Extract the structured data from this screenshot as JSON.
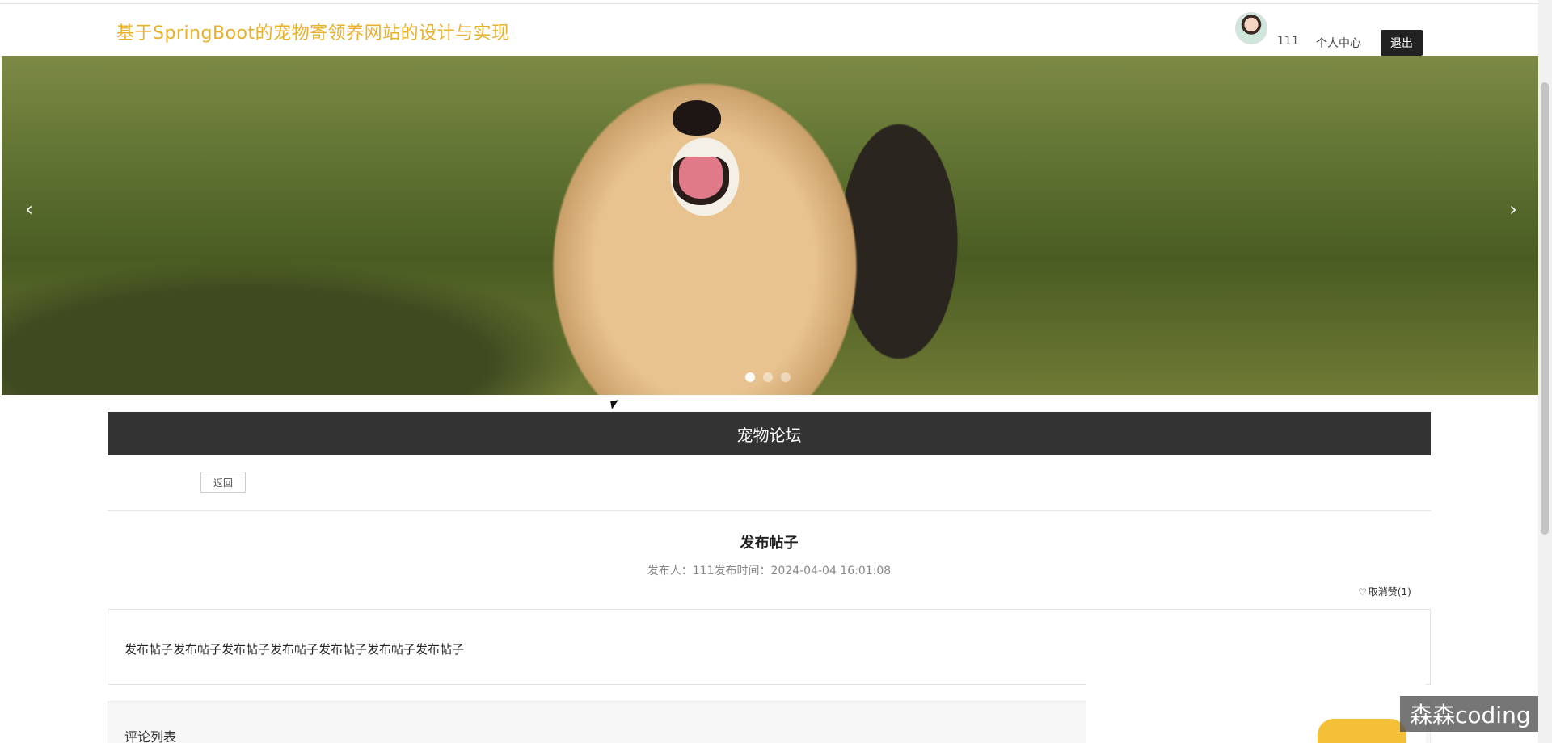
{
  "header": {
    "site_title": "基于SpringBoot的宠物寄领养网站的设计与实现",
    "username": "111",
    "profile_link": "个人中心",
    "logout_label": "退出"
  },
  "banner": {
    "prev_arrow": "‹",
    "next_arrow": "›",
    "dot_count": 3,
    "active_dot": 1
  },
  "section": {
    "title": "宠物论坛"
  },
  "actions": {
    "back_label": "返回"
  },
  "post": {
    "title": "发布帖子",
    "meta": "发布人：111发布时间：2024-04-04 16:01:08",
    "like_toggle": "取消赞(1)",
    "content": "发布帖子发布帖子发布帖子发布帖子发布帖子发布帖子发布帖子"
  },
  "comments": {
    "title": "评论列表"
  },
  "watermark": "森森coding",
  "colors": {
    "title_gold": "#e9b12a",
    "section_bar": "#333333",
    "logout_bg": "#222222"
  }
}
